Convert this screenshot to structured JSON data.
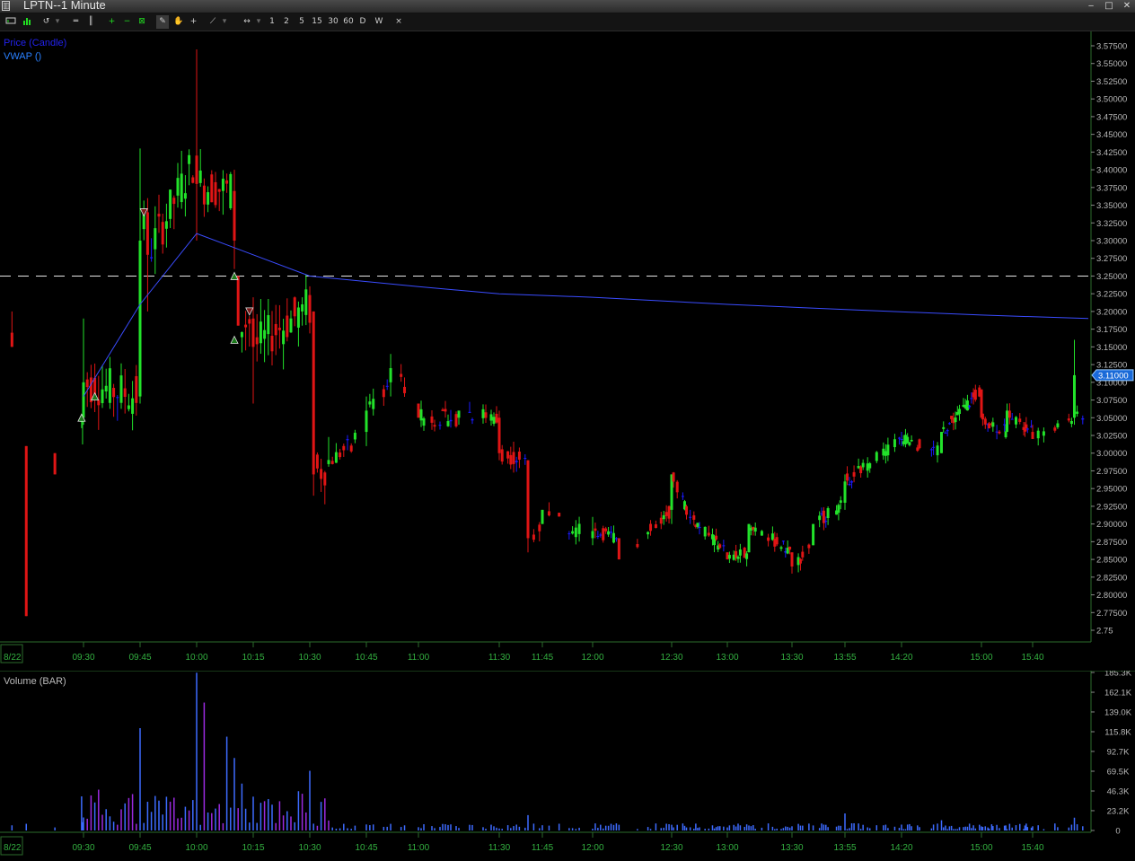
{
  "window": {
    "title": "LPTN--1 Minute",
    "minimize": "‒",
    "maximize": "□",
    "close": "✕"
  },
  "toolbar": {
    "icons": [
      "chart-type-icon",
      "bar-chart-icon",
      "undo-icon",
      "equal-lines-icon",
      "pause-lines-icon",
      "zoom-in-icon",
      "zoom-out-icon",
      "fit-icon",
      "draw-pen-icon",
      "hand-icon",
      "crosshair-icon",
      "trendline-icon",
      "scroll-arrows-icon"
    ],
    "intervals": [
      "1",
      "2",
      "5",
      "15",
      "30",
      "60",
      "D",
      "W"
    ],
    "close_x": "×"
  },
  "colors": {
    "up": "#22e22a",
    "down": "#e01515",
    "vwap": "#3a4cff",
    "legend_price": "#2222ee",
    "legend_vwap": "#2a80ff",
    "axis_text": "#b8b8b8",
    "time_text": "#33b040",
    "volume_blue": "#3d6bff",
    "volume_purple": "#9a2adf"
  },
  "price_pane": {
    "legend_price": "Price (Candle)",
    "legend_vwap": "VWAP ()",
    "last_price_label": "3.11000",
    "reference_line": 3.25
  },
  "volume_pane": {
    "legend": "Volume (BAR)"
  },
  "chart_data": [
    {
      "type": "candlestick",
      "symbol": "LPTN",
      "interval": "1 Minute",
      "date_label": "8/22",
      "x_ticks": [
        "09:30",
        "09:45",
        "10:00",
        "10:15",
        "10:30",
        "10:45",
        "11:00",
        "11:30",
        "11:45",
        "12:00",
        "12:30",
        "13:00",
        "13:30",
        "13:55",
        "14:20",
        "15:00",
        "15:40"
      ],
      "y_ticks": [
        "3.57500",
        "3.55000",
        "3.52500",
        "3.50000",
        "3.47500",
        "3.45000",
        "3.42500",
        "3.40000",
        "3.37500",
        "3.35000",
        "3.32500",
        "3.30000",
        "3.27500",
        "3.25000",
        "3.22500",
        "3.20000",
        "3.17500",
        "3.15000",
        "3.12500",
        "3.10000",
        "3.07500",
        "3.05000",
        "3.02500",
        "3.00000",
        "2.97500",
        "2.95000",
        "2.92500",
        "2.90000",
        "2.87500",
        "2.85000",
        "2.82500",
        "2.80000",
        "2.77500",
        "2.75"
      ],
      "ylim": [
        2.75,
        3.585
      ],
      "series_keypoints": [
        {
          "time": "08:15",
          "open": 3.17,
          "high": 3.2,
          "low": 3.15,
          "close": 3.15
        },
        {
          "time": "08:30",
          "open": 3.01,
          "high": 3.01,
          "low": 2.77,
          "close": 2.77
        },
        {
          "time": "09:00",
          "open": 3.0,
          "high": 3.0,
          "low": 2.97,
          "close": 2.97
        },
        {
          "time": "09:30",
          "open": 3.05,
          "high": 3.19,
          "low": 3.04,
          "close": 3.1
        },
        {
          "time": "09:45",
          "open": 3.08,
          "high": 3.43,
          "low": 3.07,
          "close": 3.3
        },
        {
          "time": "09:47",
          "open": 3.34,
          "high": 3.36,
          "low": 3.2,
          "close": 3.28
        },
        {
          "time": "10:00",
          "open": 3.42,
          "high": 3.57,
          "low": 3.3,
          "close": 3.38
        },
        {
          "time": "10:10",
          "open": 3.37,
          "high": 3.4,
          "low": 3.26,
          "close": 3.3
        },
        {
          "time": "10:11",
          "open": 3.25,
          "high": 3.25,
          "low": 3.18,
          "close": 3.18
        },
        {
          "time": "10:15",
          "open": 3.19,
          "high": 3.22,
          "low": 3.07,
          "close": 3.15
        },
        {
          "time": "10:28",
          "open": 3.2,
          "high": 3.22,
          "low": 3.18,
          "close": 3.21
        },
        {
          "time": "10:31",
          "open": 3.2,
          "high": 3.2,
          "low": 2.94,
          "close": 2.97
        },
        {
          "time": "10:45",
          "open": 3.03,
          "high": 3.08,
          "low": 3.01,
          "close": 3.06
        },
        {
          "time": "10:52",
          "open": 3.1,
          "high": 3.14,
          "low": 3.08,
          "close": 3.12
        },
        {
          "time": "11:00",
          "open": 3.07,
          "high": 3.07,
          "low": 3.05,
          "close": 3.05
        },
        {
          "time": "11:15",
          "open": 3.05,
          "high": 3.06,
          "low": 3.04,
          "close": 3.06
        },
        {
          "time": "11:30",
          "open": 3.05,
          "high": 3.06,
          "low": 2.99,
          "close": 3.0
        },
        {
          "time": "11:40",
          "open": 2.99,
          "high": 2.99,
          "low": 2.86,
          "close": 2.88
        },
        {
          "time": "11:45",
          "open": 2.9,
          "high": 2.92,
          "low": 2.9,
          "close": 2.92
        },
        {
          "time": "12:00",
          "open": 2.88,
          "high": 2.91,
          "low": 2.87,
          "close": 2.89
        },
        {
          "time": "12:10",
          "open": 2.88,
          "high": 2.88,
          "low": 2.85,
          "close": 2.85
        },
        {
          "time": "12:30",
          "open": 2.92,
          "high": 2.97,
          "low": 2.9,
          "close": 2.97
        },
        {
          "time": "12:40",
          "open": 2.91,
          "high": 2.92,
          "low": 2.9,
          "close": 2.91
        },
        {
          "time": "13:00",
          "open": 2.86,
          "high": 2.86,
          "low": 2.85,
          "close": 2.85
        },
        {
          "time": "13:10",
          "open": 2.86,
          "high": 2.9,
          "low": 2.86,
          "close": 2.9
        },
        {
          "time": "13:30",
          "open": 2.86,
          "high": 2.86,
          "low": 2.83,
          "close": 2.84
        },
        {
          "time": "13:40",
          "open": 2.87,
          "high": 2.9,
          "low": 2.87,
          "close": 2.9
        },
        {
          "time": "13:55",
          "open": 2.93,
          "high": 2.97,
          "low": 2.92,
          "close": 2.96
        },
        {
          "time": "14:20",
          "open": 3.02,
          "high": 3.03,
          "low": 3.01,
          "close": 3.02
        },
        {
          "time": "14:40",
          "open": 3.0,
          "high": 3.03,
          "low": 3.0,
          "close": 3.03
        },
        {
          "time": "15:00",
          "open": 3.09,
          "high": 3.09,
          "low": 3.05,
          "close": 3.05
        },
        {
          "time": "15:20",
          "open": 3.03,
          "high": 3.07,
          "low": 3.03,
          "close": 3.06
        },
        {
          "time": "15:40",
          "open": 3.03,
          "high": 3.04,
          "low": 3.02,
          "close": 3.02
        },
        {
          "time": "15:55",
          "open": 3.05,
          "high": 3.16,
          "low": 3.04,
          "close": 3.11
        }
      ],
      "vwap_keypoints": [
        {
          "time": "09:30",
          "value": 3.08
        },
        {
          "time": "09:45",
          "value": 3.21
        },
        {
          "time": "10:00",
          "value": 3.31
        },
        {
          "time": "10:15",
          "value": 3.28
        },
        {
          "time": "10:30",
          "value": 3.25
        },
        {
          "time": "11:00",
          "value": 3.235
        },
        {
          "time": "11:30",
          "value": 3.225
        },
        {
          "time": "12:00",
          "value": 3.22
        },
        {
          "time": "13:00",
          "value": 3.21
        },
        {
          "time": "14:00",
          "value": 3.202
        },
        {
          "time": "15:00",
          "value": 3.195
        },
        {
          "time": "16:00",
          "value": 3.19
        }
      ],
      "markers": [
        {
          "time": "09:28",
          "price": 3.05,
          "shape": "up-triangle"
        },
        {
          "time": "09:33",
          "price": 3.08,
          "shape": "up-triangle"
        },
        {
          "time": "09:46",
          "price": 3.34,
          "shape": "down-triangle"
        },
        {
          "time": "10:10",
          "price": 3.25,
          "shape": "up-triangle"
        },
        {
          "time": "10:10",
          "price": 3.16,
          "shape": "up-triangle"
        },
        {
          "time": "10:14",
          "price": 3.2,
          "shape": "down-triangle"
        }
      ]
    },
    {
      "type": "bar",
      "title": "Volume (BAR)",
      "y_ticks": [
        "185.3K",
        "162.1K",
        "139.0K",
        "115.8K",
        "92.7K",
        "69.5K",
        "46.3K",
        "23.2K",
        "0"
      ],
      "ylim": [
        0,
        185300
      ],
      "spikes": [
        {
          "time": "09:28",
          "value": 40000
        },
        {
          "time": "09:45",
          "value": 120000
        },
        {
          "time": "09:50",
          "value": 35000
        },
        {
          "time": "10:00",
          "value": 185000
        },
        {
          "time": "10:02",
          "value": 150000
        },
        {
          "time": "10:08",
          "value": 110000
        },
        {
          "time": "10:10",
          "value": 85000
        },
        {
          "time": "10:12",
          "value": 55000
        },
        {
          "time": "10:30",
          "value": 70000
        },
        {
          "time": "11:40",
          "value": 18000
        },
        {
          "time": "13:55",
          "value": 20000
        },
        {
          "time": "14:40",
          "value": 12000
        },
        {
          "time": "15:55",
          "value": 15000
        }
      ]
    }
  ]
}
